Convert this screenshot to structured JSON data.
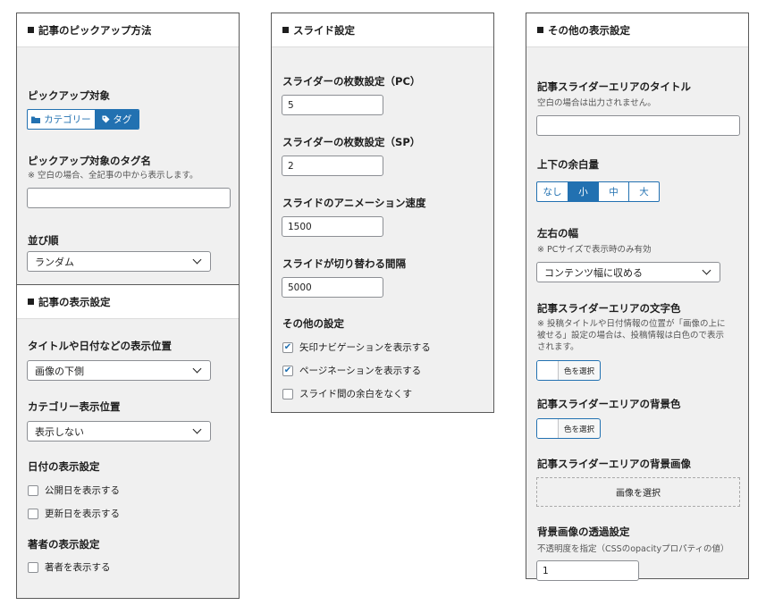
{
  "panel_pickup": {
    "title": "記事のピックアップ方法",
    "target_label": "ピックアップ対象",
    "target_options": [
      "カテゴリー",
      "タグ"
    ],
    "tag_label": "ピックアップ対象のタグ名",
    "tag_help": "※ 空白の場合、全記事の中から表示します。",
    "tag_value": "",
    "order_label": "並び順",
    "order_value": "ランダム"
  },
  "panel_display": {
    "title": "記事の表示設定",
    "position_label": "タイトルや日付などの表示位置",
    "position_value": "画像の下側",
    "category_label": "カテゴリー表示位置",
    "category_value": "表示しない",
    "date_label": "日付の表示設定",
    "date_options": [
      {
        "label": "公開日を表示する",
        "checked": false
      },
      {
        "label": "更新日を表示する",
        "checked": false
      }
    ],
    "author_label": "著者の表示設定",
    "author_options": [
      {
        "label": "著者を表示する",
        "checked": false
      }
    ]
  },
  "panel_slide": {
    "title": "スライド設定",
    "pc_label": "スライダーの枚数設定（PC）",
    "pc_value": "5",
    "sp_label": "スライダーの枚数設定（SP）",
    "sp_value": "2",
    "speed_label": "スライドのアニメーション速度",
    "speed_value": "1500",
    "interval_label": "スライドが切り替わる間隔",
    "interval_value": "5000",
    "other_label": "その他の設定",
    "other_options": [
      {
        "label": "矢印ナビゲーションを表示する",
        "checked": true
      },
      {
        "label": "ページネーションを表示する",
        "checked": true
      },
      {
        "label": "スライド間の余白をなくす",
        "checked": false
      }
    ]
  },
  "panel_other": {
    "title": "その他の表示設定",
    "area_title_label": "記事スライダーエリアのタイトル",
    "area_title_help": "空白の場合は出力されません。",
    "area_title_value": "",
    "margin_label": "上下の余白量",
    "margin_options": [
      "なし",
      "小",
      "中",
      "大"
    ],
    "margin_selected": "小",
    "width_label": "左右の幅",
    "width_help": "※ PCサイズで表示時のみ有効",
    "width_value": "コンテンツ幅に収める",
    "text_color_label": "記事スライダーエリアの文字色",
    "text_color_help": [
      "※ 投稿タイトルや日付情報の位置が「画像の上に",
      "被せる」設定の場合は、投稿情報は白色ので表示",
      "されます。"
    ],
    "select_color": "色を選択",
    "bg_color_label": "記事スライダーエリアの背景色",
    "bg_image_label": "記事スライダーエリアの背景画像",
    "select_image": "画像を選択",
    "opacity_label": "背景画像の透過設定",
    "opacity_help": "不透明度を指定（CSSのopacityプロパティの値）",
    "opacity_value": "1"
  },
  "colors": {
    "accent": "#2271b1",
    "panel_bg": "#f0f0f0",
    "border": "#5a5a5a"
  }
}
